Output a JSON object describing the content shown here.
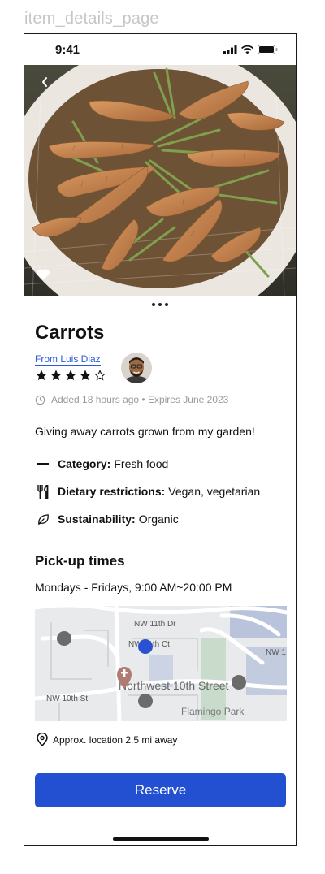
{
  "frame_label": "item_details_page",
  "status_bar": {
    "time": "9:41"
  },
  "item": {
    "title": "Carrots",
    "owner_link": "From Luis Diaz",
    "rating": 4,
    "rating_max": 5,
    "meta": "Added 18 hours ago • Expires June 2023",
    "description": "Giving away carrots grown from my garden!"
  },
  "attributes": [
    {
      "icon": "dash-icon",
      "label": "Category:",
      "value": "Fresh food"
    },
    {
      "icon": "utensils-icon",
      "label": "Dietary restrictions:",
      "value": "Vegan, vegetarian"
    },
    {
      "icon": "leaf-icon",
      "label": "Sustainability:",
      "value": "Organic"
    }
  ],
  "pickup": {
    "title": "Pick-up times",
    "hours": "Mondays - Fridays, 9:00 AM~20:00 PM"
  },
  "map": {
    "labels": {
      "nw11": "NW 11th Dr",
      "nw11ct": "NW 11th Ct",
      "nw10st": "NW 10th St",
      "nwest": "Northwest 10th Street",
      "flamingo": "Flamingo Park",
      "nwright": "NW 1"
    },
    "colors": {
      "user_pin": "#2a52d0",
      "other_pin": "#6b6b6b",
      "park": "#c9dccb",
      "water": "#b9c3dc"
    }
  },
  "location": {
    "text": "Approx. location 2.5 mi away"
  },
  "actions": {
    "reserve_label": "Reserve"
  },
  "colors": {
    "primary": "#2250d0",
    "link": "#2b5bd7"
  }
}
